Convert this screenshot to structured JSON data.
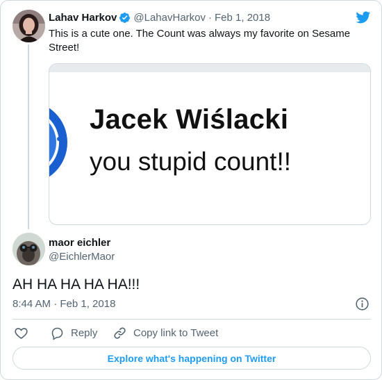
{
  "parent_tweet": {
    "display_name": "Lahav Harkov",
    "handle": "@LahavHarkov",
    "separator": "·",
    "date": "Feb 1, 2018",
    "text": "This is a cute one. The Count was always my favorite on Sesame Street!",
    "media": {
      "line1": "Jacek Wiślacki",
      "line2": "you stupid count!!"
    }
  },
  "reply_tweet": {
    "display_name": "maor eichler",
    "handle": "@EichlerMaor",
    "text": "AH HA HA HA HA!!!",
    "timestamp": "8:44 AM · Feb 1, 2018"
  },
  "actions": {
    "reply_label": "Reply",
    "copy_link_label": "Copy link to Tweet"
  },
  "explore_button": "Explore what's happening on Twitter",
  "icons": {
    "brand": "twitter-bird-icon",
    "verified": "verified-badge-icon",
    "like": "heart-icon",
    "reply": "reply-bubble-icon",
    "copy_link": "link-icon",
    "info": "info-icon"
  },
  "colors": {
    "accent": "#1d9bf0",
    "text": "#0f1419",
    "muted": "#536471",
    "border": "#cfd9de"
  }
}
